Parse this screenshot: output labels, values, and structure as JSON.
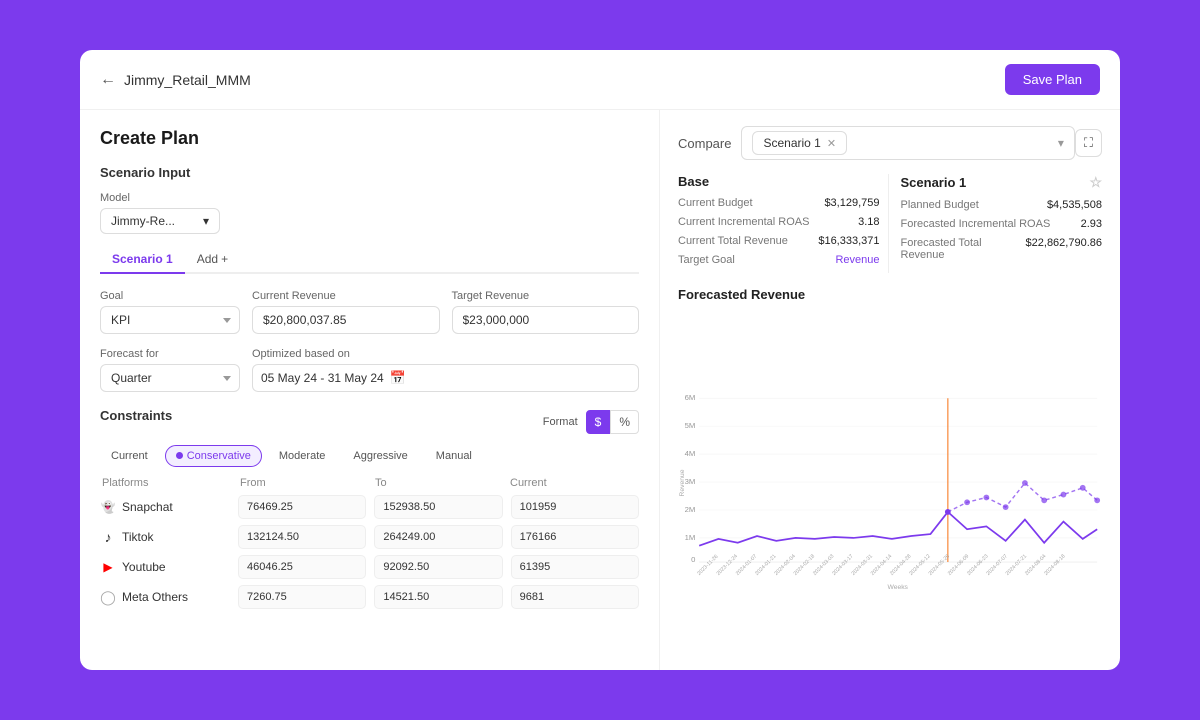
{
  "header": {
    "back_label": "←",
    "title": "Jimmy_Retail_MMM",
    "save_button": "Save Plan"
  },
  "left": {
    "page_title": "Create Plan",
    "scenario_input_label": "Scenario Input",
    "model_label": "Model",
    "model_value": "Jimmy-Re...",
    "tabs": [
      "Scenario 1",
      "Add"
    ],
    "active_tab": "Scenario 1",
    "goal_label": "Goal",
    "goal_value": "KPI",
    "current_revenue_label": "Current Revenue",
    "current_revenue_value": "$20,800,037.85",
    "target_revenue_label": "Target Revenue",
    "target_revenue_value": "$23,000,000",
    "forecast_for_label": "Forecast for",
    "forecast_for_value": "Quarter",
    "optimized_based_on_label": "Optimized based on",
    "date_range": "05 May 24 - 31 May 24",
    "constraints_label": "Constraints",
    "format_label": "Format",
    "constraint_tabs": [
      "Current",
      "Conservative",
      "Moderate",
      "Aggressive",
      "Manual"
    ],
    "active_constraint": "Conservative",
    "format_dollar": "$",
    "format_percent": "%",
    "platforms_header": {
      "platform": "Platforms",
      "from": "From",
      "to": "To",
      "current": "Current"
    },
    "platforms": [
      {
        "name": "Snapchat",
        "icon": "snapchat",
        "from": "76469.25",
        "to": "152938.50",
        "current": "101959"
      },
      {
        "name": "Tiktok",
        "icon": "tiktok",
        "from": "132124.50",
        "to": "264249.00",
        "current": "176166"
      },
      {
        "name": "Youtube",
        "icon": "youtube",
        "from": "46046.25",
        "to": "92092.50",
        "current": "61395"
      },
      {
        "name": "Meta Others",
        "icon": "meta",
        "from": "7260.75",
        "to": "14521.50",
        "current": "9681"
      }
    ]
  },
  "right": {
    "compare_label": "Compare",
    "scenario_chip": "Scenario 1",
    "base_label": "Base",
    "scenario1_label": "Scenario 1",
    "base": {
      "current_budget_label": "Current Budget",
      "current_budget_value": "$3,129,759",
      "current_incremental_roas_label": "Current Incremental ROAS",
      "current_incremental_roas_value": "3.18",
      "current_total_revenue_label": "Current Total Revenue",
      "current_total_revenue_value": "$16,333,371",
      "target_goal_label": "Target Goal",
      "target_goal_value": "Revenue"
    },
    "scenario1": {
      "planned_budget_label": "Planned Budget",
      "planned_budget_value": "$4,535,508",
      "forecasted_incremental_roas_label": "Forecasted Incremental ROAS",
      "forecasted_incremental_roas_value": "2.93",
      "forecasted_total_revenue_label": "Forecasted Total Revenue",
      "forecasted_total_revenue_value": "$22,862,790.86"
    },
    "chart_title": "Forecasted Revenue",
    "chart": {
      "y_labels": [
        "6M",
        "5M",
        "4M",
        "3M",
        "2M",
        "1M",
        "0"
      ],
      "y_axis_label": "Revenue",
      "x_axis_label": "Weeks",
      "x_labels": [
        "2023-11-26",
        "2023-12-24",
        "2024-01-07",
        "2024-01-21",
        "2024-02-04",
        "2024-02-18",
        "2024-03-03",
        "2024-03-17",
        "2024-03-31",
        "2024-04-14",
        "2024-04-28",
        "2024-05-12",
        "2024-05-26",
        "2024-06-09",
        "2024-06-23",
        "2024-07-07",
        "2024-07-21",
        "2024-08-04",
        "2024-08-18"
      ]
    }
  }
}
